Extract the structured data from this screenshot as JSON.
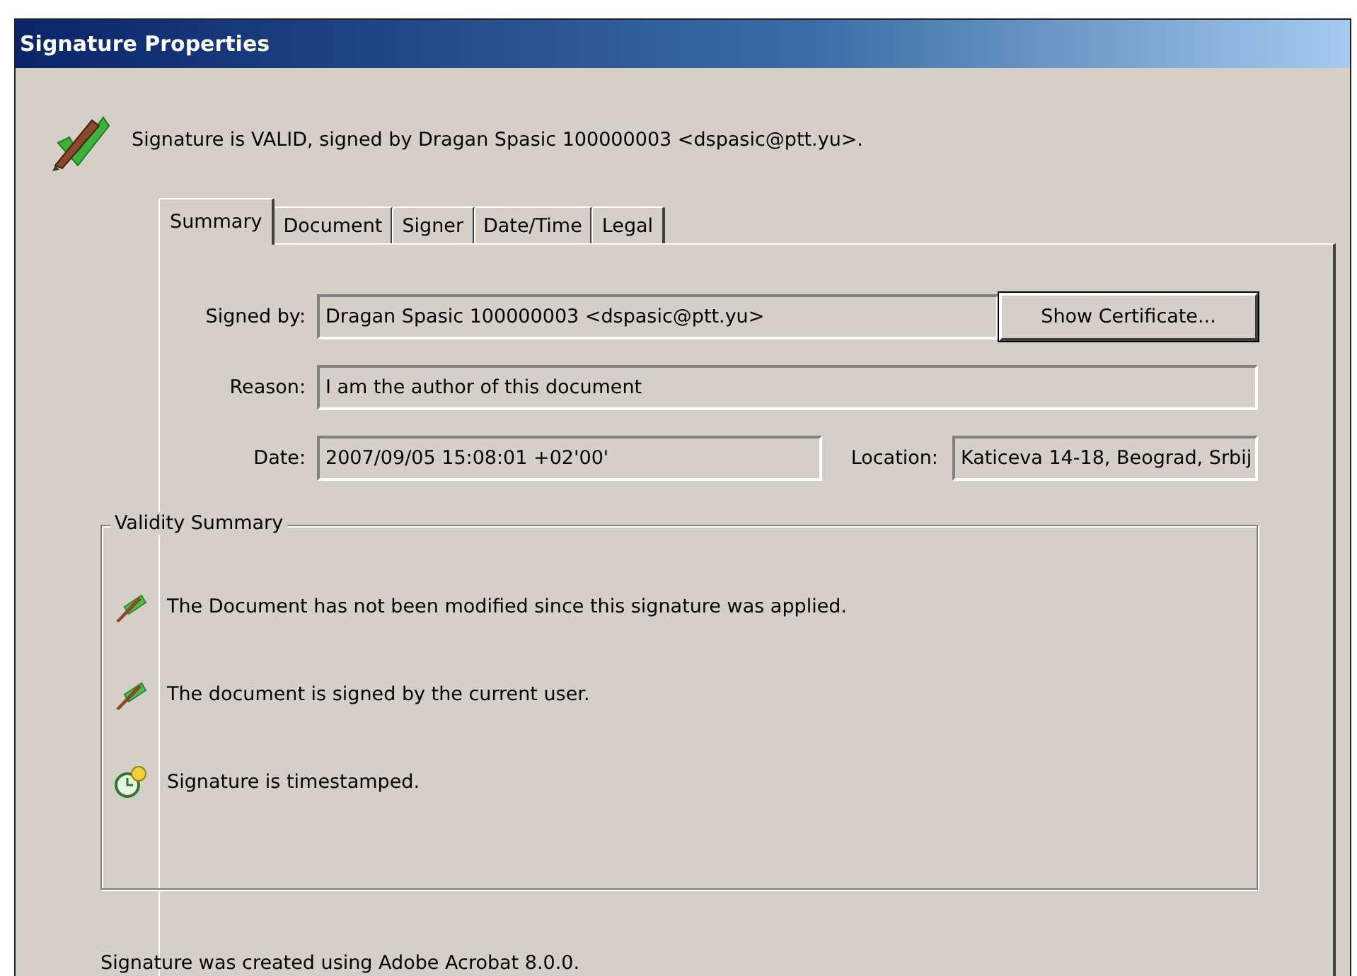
{
  "window": {
    "title": "Signature Properties"
  },
  "status_message": "Signature is VALID, signed by Dragan Spasic 100000003 <dspasic@ptt.yu>.",
  "tabs": [
    {
      "label": "Summary",
      "selected": true
    },
    {
      "label": "Document",
      "selected": false
    },
    {
      "label": "Signer",
      "selected": false
    },
    {
      "label": "Date/Time",
      "selected": false
    },
    {
      "label": "Legal",
      "selected": false
    }
  ],
  "fields": {
    "signed_by": {
      "label": "Signed by:",
      "value": "Dragan Spasic 100000003 <dspasic@ptt.yu>"
    },
    "reason": {
      "label": "Reason:",
      "value": "I am the author of this document"
    },
    "date": {
      "label": "Date:",
      "value": "2007/09/05 15:08:01 +02'00'"
    },
    "location": {
      "label": "Location:",
      "value": "Katiceva 14-18, Beograd, Srbij"
    }
  },
  "show_certificate_button": "Show Certificate...",
  "validity_summary": {
    "title": "Validity Summary",
    "items": [
      {
        "kind": "signature",
        "text": "The Document has not been modified since this signature was applied."
      },
      {
        "kind": "signature",
        "text": "The document is signed by the current user."
      },
      {
        "kind": "timestamp",
        "text": "Signature is timestamped."
      }
    ]
  },
  "footer": "Signature was created using Adobe Acrobat 8.0.0."
}
